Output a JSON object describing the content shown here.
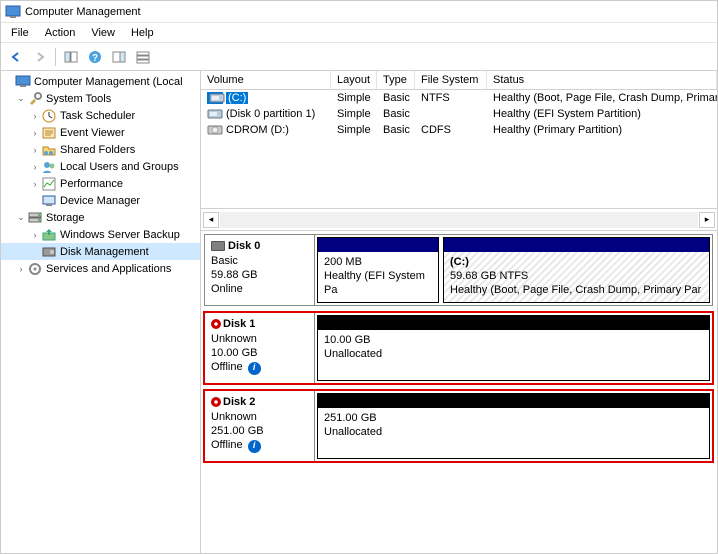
{
  "title": "Computer Management",
  "menu": {
    "file": "File",
    "action": "Action",
    "view": "View",
    "help": "Help"
  },
  "tree": {
    "root": "Computer Management (Local",
    "system_tools": "System Tools",
    "task_scheduler": "Task Scheduler",
    "event_viewer": "Event Viewer",
    "shared_folders": "Shared Folders",
    "local_users": "Local Users and Groups",
    "performance": "Performance",
    "device_manager": "Device Manager",
    "storage": "Storage",
    "wsb": "Windows Server Backup",
    "disk_mgmt": "Disk Management",
    "services_apps": "Services and Applications"
  },
  "vl_headers": {
    "volume": "Volume",
    "layout": "Layout",
    "type": "Type",
    "fs": "File System",
    "status": "Status"
  },
  "volumes": [
    {
      "name": "(C:)",
      "layout": "Simple",
      "type": "Basic",
      "fs": "NTFS",
      "status": "Healthy (Boot, Page File, Crash Dump, Primary Partition)"
    },
    {
      "name": "(Disk 0 partition 1)",
      "layout": "Simple",
      "type": "Basic",
      "fs": "",
      "status": "Healthy (EFI System Partition)"
    },
    {
      "name": "CDROM (D:)",
      "layout": "Simple",
      "type": "Basic",
      "fs": "CDFS",
      "status": "Healthy (Primary Partition)"
    }
  ],
  "disks": [
    {
      "name": "Disk 0",
      "type": "Basic",
      "size": "59.88 GB",
      "status": "Online",
      "parts": [
        {
          "label": "",
          "size": "200 MB",
          "desc": "Healthy (EFI System Pa",
          "hdr": "navy",
          "hatched": false,
          "width": 122
        },
        {
          "label": "(C:)",
          "size": "59.68 GB NTFS",
          "desc": "Healthy (Boot, Page File, Crash Dump, Primary Par",
          "hdr": "navy",
          "hatched": true,
          "width": 0
        }
      ],
      "highlighted": false,
      "offline": false
    },
    {
      "name": "Disk 1",
      "type": "Unknown",
      "size": "10.00 GB",
      "status": "Offline",
      "parts": [
        {
          "label": "",
          "size": "10.00 GB",
          "desc": "Unallocated",
          "hdr": "black",
          "hatched": false,
          "width": 0
        }
      ],
      "highlighted": true,
      "offline": true
    },
    {
      "name": "Disk 2",
      "type": "Unknown",
      "size": "251.00 GB",
      "status": "Offline",
      "parts": [
        {
          "label": "",
          "size": "251.00 GB",
          "desc": "Unallocated",
          "hdr": "black",
          "hatched": false,
          "width": 0
        }
      ],
      "highlighted": true,
      "offline": true
    }
  ]
}
